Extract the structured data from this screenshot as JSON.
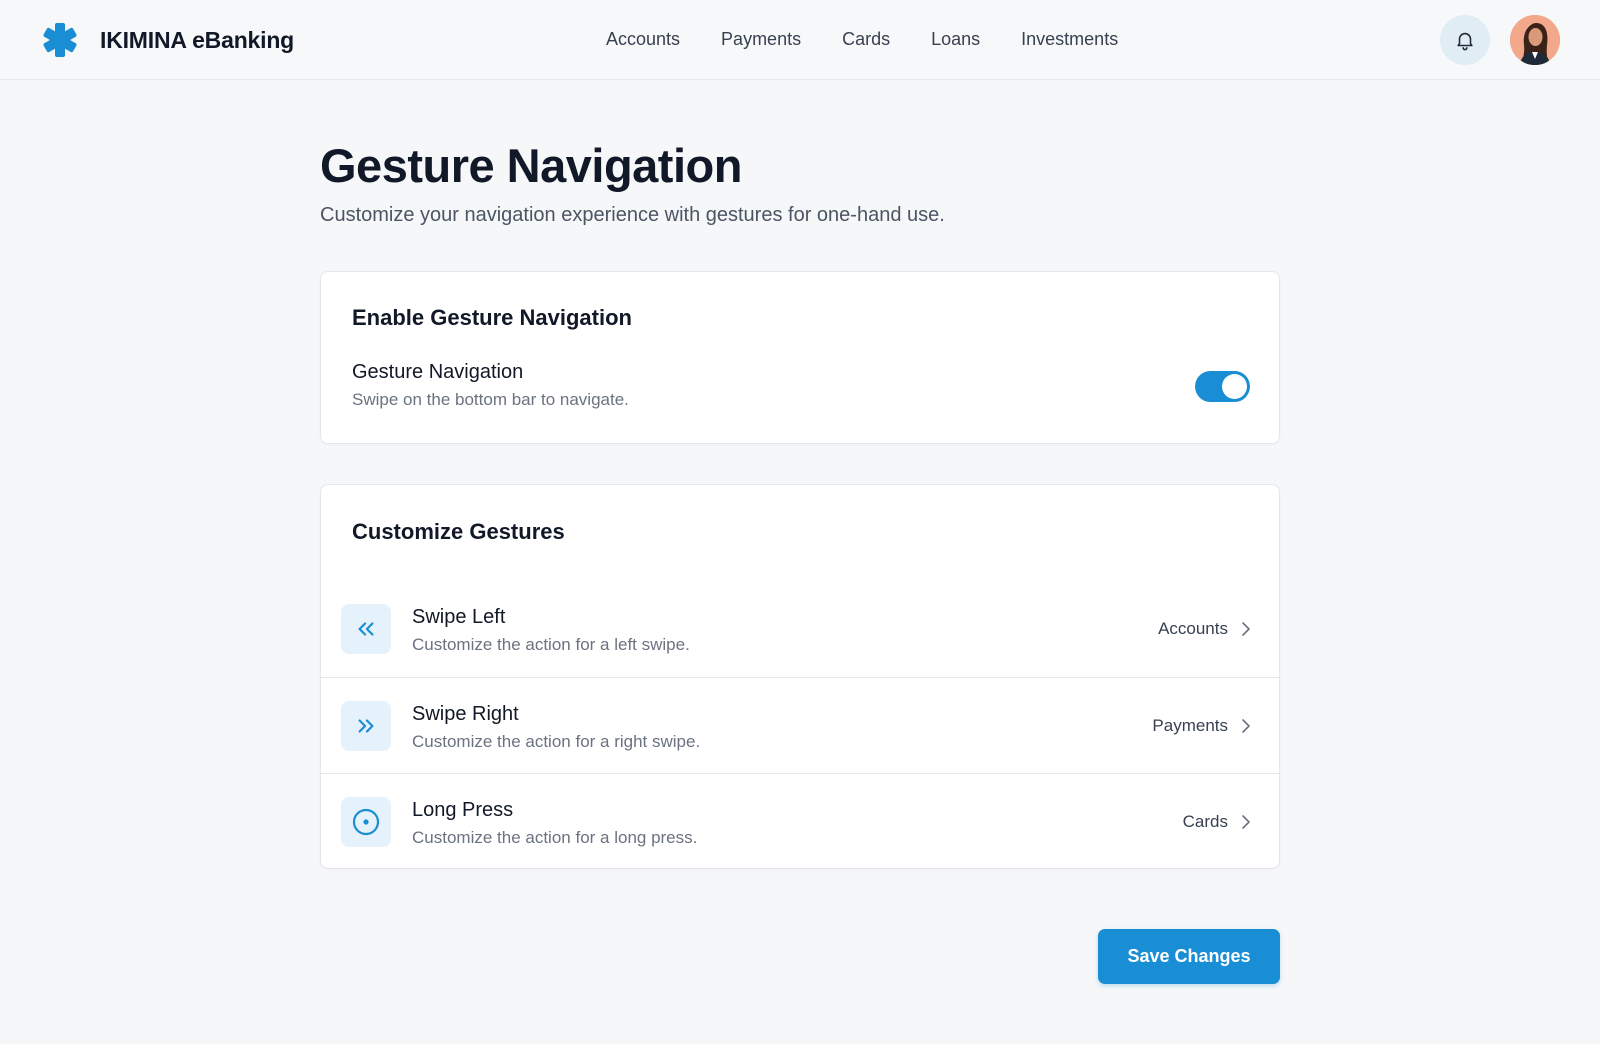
{
  "header": {
    "brand_name": "IKIMINA eBanking",
    "brand_icon": "asterisk-logo-icon",
    "nav": [
      "Accounts",
      "Payments",
      "Cards",
      "Loans",
      "Investments"
    ],
    "notification_icon": "bell-icon",
    "avatar": "user-avatar"
  },
  "page": {
    "title": "Gesture Navigation",
    "subtitle": "Customize your navigation experience with gestures for one-hand use."
  },
  "enable_card": {
    "title": "Enable Gesture Navigation",
    "option_label": "Gesture Navigation",
    "option_description": "Swipe on the bottom bar to navigate.",
    "toggle_on": true
  },
  "customize_card": {
    "title": "Customize Gestures",
    "gestures": [
      {
        "label": "Swipe Left",
        "description": "Customize the action for a left swipe.",
        "value": "Accounts",
        "icon": "double-chevron-left-icon"
      },
      {
        "label": "Swipe Right",
        "description": "Customize the action for a right swipe.",
        "value": "Payments",
        "icon": "double-chevron-right-icon"
      },
      {
        "label": "Long Press",
        "description": "Customize the action for a long press.",
        "value": "Cards",
        "icon": "target-circle-icon"
      }
    ]
  },
  "actions": {
    "save_label": "Save Changes"
  },
  "colors": {
    "accent": "#1a8ed4",
    "background": "#f5f7f9",
    "icon_tile": "#e6f2fb"
  }
}
